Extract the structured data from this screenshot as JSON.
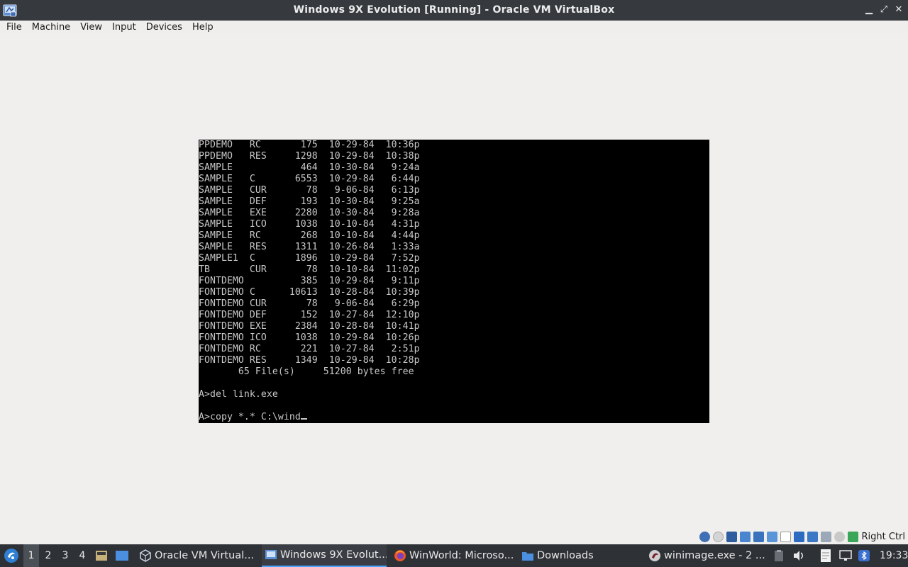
{
  "window": {
    "title": "Windows 9X Evolution [Running] - Oracle VM VirtualBox",
    "minimize_glyph": "▁",
    "restore_glyph": "⤢",
    "close_glyph": "✕"
  },
  "menu": [
    "File",
    "Machine",
    "View",
    "Input",
    "Devices",
    "Help"
  ],
  "dos": {
    "lines": [
      "PPDEMO   RC       175  10-29-84  10:36p",
      "PPDEMO   RES     1298  10-29-84  10:38p",
      "SAMPLE            464  10-30-84   9:24a",
      "SAMPLE   C       6553  10-29-84   6:44p",
      "SAMPLE   CUR       78   9-06-84   6:13p",
      "SAMPLE   DEF      193  10-30-84   9:25a",
      "SAMPLE   EXE     2280  10-30-84   9:28a",
      "SAMPLE   ICO     1038  10-10-84   4:31p",
      "SAMPLE   RC       268  10-10-84   4:44p",
      "SAMPLE   RES     1311  10-26-84   1:33a",
      "SAMPLE1  C       1896  10-29-84   7:52p",
      "TB       CUR       78  10-10-84  11:02p",
      "FONTDEMO          385  10-29-84   9:11p",
      "FONTDEMO C      10613  10-28-84  10:39p",
      "FONTDEMO CUR       78   9-06-84   6:29p",
      "FONTDEMO DEF      152  10-27-84  12:10p",
      "FONTDEMO EXE     2384  10-28-84  10:41p",
      "FONTDEMO ICO     1038  10-29-84  10:26p",
      "FONTDEMO RC       221  10-27-84   2:51p",
      "FONTDEMO RES     1349  10-29-84  10:28p",
      "       65 File(s)     51200 bytes free",
      "",
      "A>del link.exe",
      ""
    ],
    "prompt_line": "A>copy *.* C:\\wind"
  },
  "vbox_status": {
    "icons": [
      "hard-disk-icon",
      "optical-drive-icon",
      "floppy-icon",
      "audio-icon",
      "network-icon",
      "usb-icon",
      "shared-folders-icon",
      "display-icon",
      "video-capture-icon",
      "mouse-integration-icon",
      "vt-x-icon",
      "arrow-down-icon"
    ],
    "host_key": "Right Ctrl"
  },
  "taskbar": {
    "workspaces": [
      "1",
      "2",
      "3",
      "4"
    ],
    "tasks": [
      {
        "label": "Oracle VM Virtual...",
        "icon": "virtualbox-icon",
        "active": false
      },
      {
        "label": "Windows 9X Evolut...",
        "icon": "vm-window-icon",
        "active": true
      },
      {
        "label": "WinWorld: Microso...",
        "icon": "firefox-icon",
        "active": false
      },
      {
        "label": "Downloads",
        "icon": "folder-icon",
        "active": false
      },
      {
        "label": "winimage.exe - 2 ...",
        "icon": "wine-icon",
        "active": false
      }
    ],
    "clock": "19:33"
  }
}
